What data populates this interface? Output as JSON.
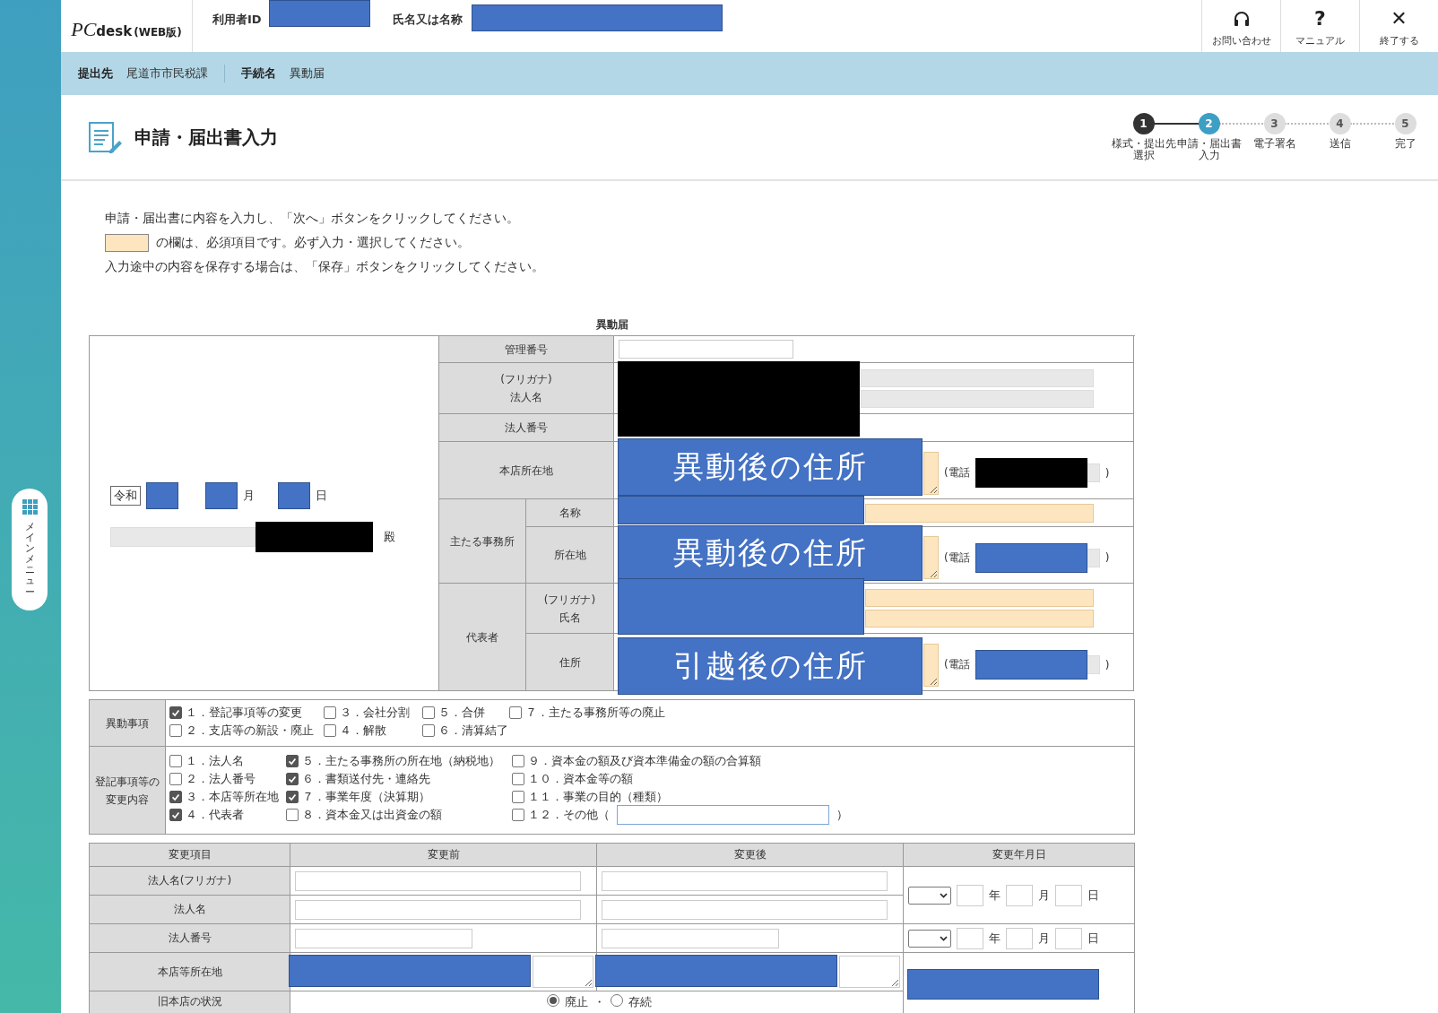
{
  "sidebar": {
    "menu_label": "メインメニュー"
  },
  "header": {
    "logo": {
      "brand": "PC",
      "product": "desk",
      "edition": "(WEB版)"
    },
    "user_id_label": "利用者ID",
    "name_label": "氏名又は名称",
    "actions": [
      {
        "kind": "headset",
        "label": "お問い合わせ"
      },
      {
        "kind": "glyph",
        "glyph": "?",
        "label": "マニュアル"
      },
      {
        "kind": "glyph",
        "glyph": "✕",
        "label": "終了する"
      }
    ]
  },
  "info_bar": [
    {
      "label": "提出先",
      "value": "尾道市市民税課"
    },
    {
      "label": "手続名",
      "value": "異動届"
    }
  ],
  "page_title": "申請・届出書入力",
  "steps": [
    {
      "number": "1",
      "label": "様式・提出先選択",
      "completed": true,
      "selected": false
    },
    {
      "number": "2",
      "label": "申請・届出書入力",
      "completed": false,
      "selected": true
    },
    {
      "number": "3",
      "label": "電子署名",
      "completed": false,
      "selected": false
    },
    {
      "number": "4",
      "label": "送信",
      "completed": false,
      "selected": false
    },
    {
      "number": "5",
      "label": "完了",
      "completed": false,
      "selected": false
    }
  ],
  "instructions": {
    "line1": "申請・届出書に内容を入力し、「次へ」ボタンをクリックしてください。",
    "required_note": "の欄は、必須項目です。必ず入力・選択してください。",
    "line3": "入力途中の内容を保存する場合は、「保存」ボタンをクリックしてください。"
  },
  "form": {
    "title": "異動届",
    "left": {
      "era": "令和",
      "month_unit": "月",
      "day_unit": "日",
      "addressee_suffix": "殿"
    },
    "management_number": {
      "label": "管理番号"
    },
    "corp_name": {
      "label": "(フリガナ)\n法人名"
    },
    "corp_number": {
      "label": "法人番号"
    },
    "head_office": {
      "label": "本店所在地",
      "overlay_label": "異動後の住所",
      "phone_label": "(電話",
      "phone_close": ")"
    },
    "main_office": {
      "label": "主たる事務所",
      "name_label": "名称",
      "address_label": "所在地",
      "overlay_label": "異動後の住所",
      "phone_label": "(電話",
      "phone_close": ")"
    },
    "representative": {
      "label": "代表者",
      "name_label": "(フリガナ)\n氏名",
      "address_label": "住所",
      "overlay_label": "引越後の住所",
      "phone_label": "(電話",
      "phone_close": ")"
    },
    "change_matters": {
      "label": "異動事項",
      "items": [
        {
          "label": "１．登記事項等の変更",
          "checked": true
        },
        {
          "label": "２．支店等の新設・廃止",
          "checked": false
        },
        {
          "label": "３．会社分割",
          "checked": false
        },
        {
          "label": "４．解散",
          "checked": false
        },
        {
          "label": "５．合併",
          "checked": false
        },
        {
          "label": "６．清算結了",
          "checked": false
        },
        {
          "label": "７．主たる事務所等の廃止",
          "checked": false
        }
      ]
    },
    "registry_changes": {
      "label": "登記事項等の変更内容",
      "items": [
        {
          "kind": "plain",
          "label": "１．法人名",
          "checked": false
        },
        {
          "kind": "plain",
          "label": "２．法人番号",
          "checked": false
        },
        {
          "kind": "plain",
          "label": "３．本店等所在地",
          "checked": true
        },
        {
          "kind": "plain",
          "label": "４．代表者",
          "checked": true
        },
        {
          "kind": "plain",
          "label": "５．主たる事務所の所在地（納税地）",
          "checked": true
        },
        {
          "kind": "plain",
          "label": "６．書類送付先・連絡先",
          "checked": true
        },
        {
          "kind": "plain",
          "label": "７．事業年度（決算期）",
          "checked": true
        },
        {
          "kind": "plain",
          "label": "８．資本金又は出資金の額",
          "checked": false
        },
        {
          "kind": "plain",
          "label": "９．資本金の額及び資本準備金の額の合算額",
          "checked": false
        },
        {
          "kind": "plain",
          "label": "１０．資本金等の額",
          "checked": false
        },
        {
          "kind": "plain",
          "label": "１１．事業の目的（種類）",
          "checked": false
        },
        {
          "kind": "other",
          "label": "１２．その他（",
          "closing": "）",
          "checked": false
        }
      ]
    }
  },
  "change_table": {
    "columns": [
      "変更項目",
      "変更前",
      "変更後",
      "変更年月日"
    ],
    "rows": [
      {
        "label": "法人名(フリガナ)"
      },
      {
        "label": "法人名"
      },
      {
        "label": "法人番号"
      },
      {
        "label": "本店等所在地"
      },
      {
        "label": "旧本店の状況"
      }
    ],
    "date_fields": [
      {
        "units": [
          "年",
          "月",
          "日"
        ]
      },
      {
        "units": [
          "年",
          "月",
          "日"
        ]
      }
    ],
    "old_office_status": {
      "options": [
        {
          "label": "廃止",
          "selected": true
        },
        {
          "label": "存続",
          "selected": false
        }
      ],
      "separator": "・"
    }
  }
}
